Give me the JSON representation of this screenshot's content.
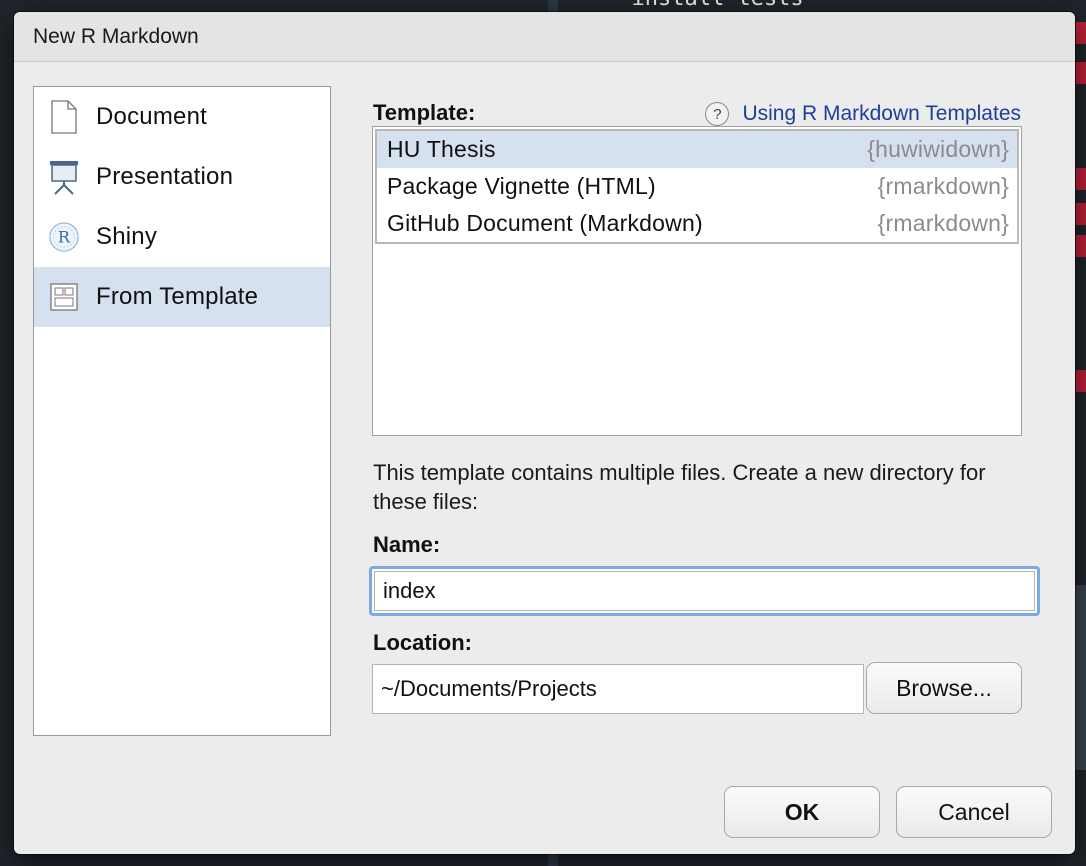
{
  "background": {
    "code_line": "--install-tests"
  },
  "dialog": {
    "title": "New R Markdown"
  },
  "types": [
    {
      "label": "Document",
      "icon": "document-icon",
      "selected": false
    },
    {
      "label": "Presentation",
      "icon": "presentation-icon",
      "selected": false
    },
    {
      "label": "Shiny",
      "icon": "shiny-icon",
      "selected": false
    },
    {
      "label": "From Template",
      "icon": "template-icon",
      "selected": true
    }
  ],
  "template": {
    "label": "Template:",
    "help_link": "Using R Markdown Templates",
    "help_icon_glyph": "?",
    "items": [
      {
        "name": "HU Thesis",
        "package": "{huwiwidown}",
        "selected": true
      },
      {
        "name": "Package Vignette (HTML)",
        "package": "{rmarkdown}",
        "selected": false
      },
      {
        "name": "GitHub Document (Markdown)",
        "package": "{rmarkdown}",
        "selected": false
      }
    ]
  },
  "info_text": "This template contains multiple files. Create a new directory for these files:",
  "name": {
    "label": "Name:",
    "value": "index"
  },
  "location": {
    "label": "Location:",
    "value": "~/Documents/Projects",
    "browse_label": "Browse..."
  },
  "buttons": {
    "ok": "OK",
    "cancel": "Cancel"
  },
  "colors": {
    "selection": "#d5e1ee",
    "link": "#1c3f9a",
    "focus_ring": "#7da7e6"
  }
}
